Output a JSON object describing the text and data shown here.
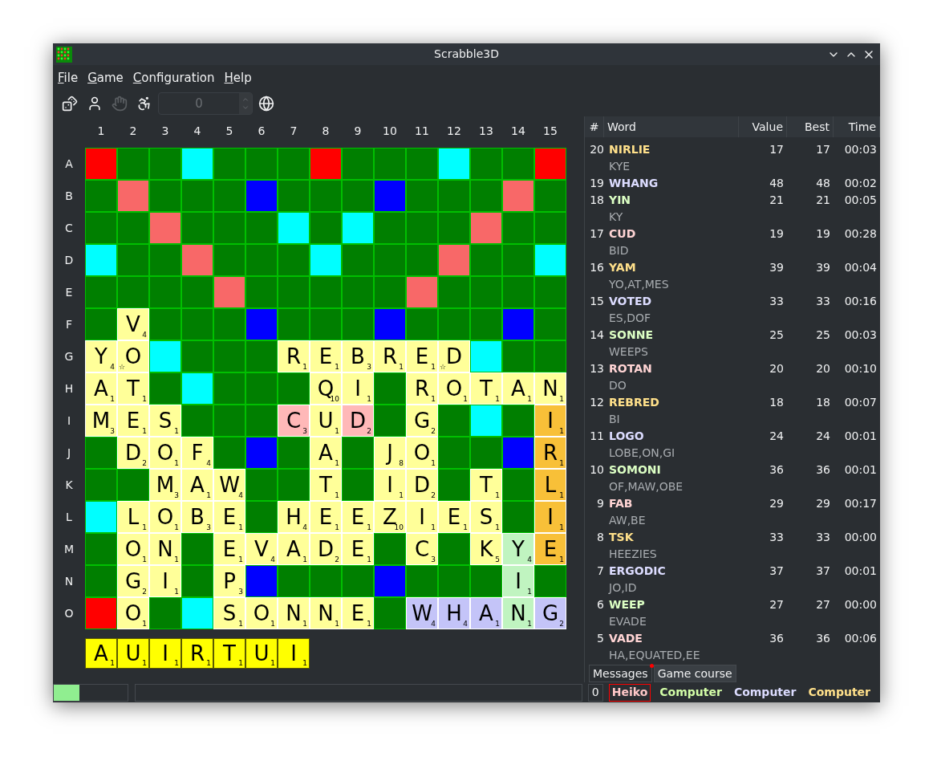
{
  "window": {
    "title": "Scrabble3D"
  },
  "menu": [
    {
      "label": "File"
    },
    {
      "label": "Game"
    },
    {
      "label": "Configuration"
    },
    {
      "label": "Help"
    }
  ],
  "toolbar": [
    {
      "kind": "dice",
      "disabled": false
    },
    {
      "kind": "player",
      "disabled": false
    },
    {
      "kind": "hand",
      "disabled": true
    },
    {
      "kind": "accessibility",
      "disabled": false
    },
    {
      "kind": "spinbox",
      "value": "0",
      "disabled": true
    },
    {
      "kind": "globe",
      "disabled": false
    }
  ],
  "board": {
    "columns": [
      "1",
      "2",
      "3",
      "4",
      "5",
      "6",
      "7",
      "8",
      "9",
      "10",
      "11",
      "12",
      "13",
      "14",
      "15"
    ],
    "rows": [
      {
        "label": "A",
        "cells": [
          {
            "kind": "tw"
          },
          {
            "kind": "plain"
          },
          {
            "kind": "plain"
          },
          {
            "kind": "dl"
          },
          {
            "kind": "plain"
          },
          {
            "kind": "plain"
          },
          {
            "kind": "plain"
          },
          {
            "kind": "tw"
          },
          {
            "kind": "plain"
          },
          {
            "kind": "plain"
          },
          {
            "kind": "plain"
          },
          {
            "kind": "dl"
          },
          {
            "kind": "plain"
          },
          {
            "kind": "plain"
          },
          {
            "kind": "tw"
          }
        ]
      },
      {
        "label": "B",
        "cells": [
          {
            "kind": "plain"
          },
          {
            "kind": "dw"
          },
          {
            "kind": "plain"
          },
          {
            "kind": "plain"
          },
          {
            "kind": "plain"
          },
          {
            "kind": "tl"
          },
          {
            "kind": "plain"
          },
          {
            "kind": "plain"
          },
          {
            "kind": "plain"
          },
          {
            "kind": "tl"
          },
          {
            "kind": "plain"
          },
          {
            "kind": "plain"
          },
          {
            "kind": "plain"
          },
          {
            "kind": "dw"
          },
          {
            "kind": "plain"
          }
        ]
      },
      {
        "label": "C",
        "cells": [
          {
            "kind": "plain"
          },
          {
            "kind": "plain"
          },
          {
            "kind": "dw"
          },
          {
            "kind": "plain"
          },
          {
            "kind": "plain"
          },
          {
            "kind": "plain"
          },
          {
            "kind": "dl"
          },
          {
            "kind": "plain"
          },
          {
            "kind": "dl"
          },
          {
            "kind": "plain"
          },
          {
            "kind": "plain"
          },
          {
            "kind": "plain"
          },
          {
            "kind": "dw"
          },
          {
            "kind": "plain"
          },
          {
            "kind": "plain"
          }
        ]
      },
      {
        "label": "D",
        "cells": [
          {
            "kind": "dl"
          },
          {
            "kind": "plain"
          },
          {
            "kind": "plain"
          },
          {
            "kind": "dw"
          },
          {
            "kind": "plain"
          },
          {
            "kind": "plain"
          },
          {
            "kind": "plain"
          },
          {
            "kind": "dl"
          },
          {
            "kind": "plain"
          },
          {
            "kind": "plain"
          },
          {
            "kind": "plain"
          },
          {
            "kind": "dw"
          },
          {
            "kind": "plain"
          },
          {
            "kind": "plain"
          },
          {
            "kind": "dl"
          }
        ]
      },
      {
        "label": "E",
        "cells": [
          {
            "kind": "plain"
          },
          {
            "kind": "plain"
          },
          {
            "kind": "plain"
          },
          {
            "kind": "plain"
          },
          {
            "kind": "dw"
          },
          {
            "kind": "plain"
          },
          {
            "kind": "plain"
          },
          {
            "kind": "plain"
          },
          {
            "kind": "plain"
          },
          {
            "kind": "plain"
          },
          {
            "kind": "dw"
          },
          {
            "kind": "plain"
          },
          {
            "kind": "plain"
          },
          {
            "kind": "plain"
          },
          {
            "kind": "plain"
          }
        ]
      },
      {
        "label": "F",
        "cells": [
          {
            "kind": "plain"
          },
          {
            "kind": "tile",
            "letter": "V",
            "points": "4",
            "color": "#ffff99"
          },
          {
            "kind": "plain"
          },
          {
            "kind": "plain"
          },
          {
            "kind": "plain"
          },
          {
            "kind": "tl"
          },
          {
            "kind": "plain"
          },
          {
            "kind": "plain"
          },
          {
            "kind": "plain"
          },
          {
            "kind": "tl"
          },
          {
            "kind": "plain"
          },
          {
            "kind": "plain"
          },
          {
            "kind": "plain"
          },
          {
            "kind": "tl"
          },
          {
            "kind": "plain"
          }
        ]
      },
      {
        "label": "G",
        "cells": [
          {
            "kind": "tile",
            "letter": "Y",
            "points": "4",
            "color": "#ffff99"
          },
          {
            "kind": "tile",
            "letter": "O",
            "mark": "☆",
            "color": "#ffff99"
          },
          {
            "kind": "dl"
          },
          {
            "kind": "plain"
          },
          {
            "kind": "plain"
          },
          {
            "kind": "plain"
          },
          {
            "kind": "tile",
            "letter": "R",
            "points": "1",
            "color": "#ffff99"
          },
          {
            "kind": "tile",
            "letter": "E",
            "points": "1",
            "color": "#ffff99"
          },
          {
            "kind": "tile",
            "letter": "B",
            "points": "3",
            "color": "#ffff99"
          },
          {
            "kind": "tile",
            "letter": "R",
            "points": "1",
            "color": "#ffff99"
          },
          {
            "kind": "tile",
            "letter": "E",
            "points": "1",
            "color": "#ffff99"
          },
          {
            "kind": "tile",
            "letter": "D",
            "mark": "☆",
            "color": "#ffff99"
          },
          {
            "kind": "dl"
          },
          {
            "kind": "plain"
          },
          {
            "kind": "plain"
          }
        ]
      },
      {
        "label": "H",
        "cells": [
          {
            "kind": "tile",
            "letter": "A",
            "points": "1",
            "color": "#ffff99"
          },
          {
            "kind": "tile",
            "letter": "T",
            "points": "1",
            "color": "#ffff99"
          },
          {
            "kind": "plain"
          },
          {
            "kind": "dl"
          },
          {
            "kind": "plain"
          },
          {
            "kind": "plain"
          },
          {
            "kind": "plain"
          },
          {
            "kind": "tile",
            "letter": "Q",
            "points": "10",
            "color": "#ffff99"
          },
          {
            "kind": "tile",
            "letter": "I",
            "points": "1",
            "color": "#ffff99"
          },
          {
            "kind": "plain"
          },
          {
            "kind": "tile",
            "letter": "R",
            "points": "1",
            "color": "#ffff99"
          },
          {
            "kind": "tile",
            "letter": "O",
            "points": "1",
            "color": "#ffff99"
          },
          {
            "kind": "tile",
            "letter": "T",
            "points": "1",
            "color": "#ffff99"
          },
          {
            "kind": "tile",
            "letter": "A",
            "points": "1",
            "color": "#ffff99"
          },
          {
            "kind": "tile",
            "letter": "N",
            "points": "1",
            "color": "#ffff99"
          }
        ]
      },
      {
        "label": "I",
        "cells": [
          {
            "kind": "tile",
            "letter": "M",
            "points": "3",
            "color": "#ffff99"
          },
          {
            "kind": "tile",
            "letter": "E",
            "points": "1",
            "color": "#ffff99"
          },
          {
            "kind": "tile",
            "letter": "S",
            "points": "1",
            "color": "#ffff99"
          },
          {
            "kind": "plain"
          },
          {
            "kind": "plain"
          },
          {
            "kind": "plain"
          },
          {
            "kind": "tile",
            "letter": "C",
            "points": "3",
            "color": "#ffb8b8"
          },
          {
            "kind": "tile",
            "letter": "U",
            "points": "1",
            "color": "#ffff99"
          },
          {
            "kind": "tile",
            "letter": "D",
            "points": "2",
            "color": "#ffb8b8"
          },
          {
            "kind": "plain"
          },
          {
            "kind": "tile",
            "letter": "G",
            "points": "2",
            "color": "#ffff99"
          },
          {
            "kind": "plain"
          },
          {
            "kind": "dl"
          },
          {
            "kind": "plain"
          },
          {
            "kind": "tile",
            "letter": "I",
            "points": "1",
            "color": "#f8c038"
          }
        ]
      },
      {
        "label": "J",
        "cells": [
          {
            "kind": "plain"
          },
          {
            "kind": "tile",
            "letter": "D",
            "points": "2",
            "color": "#ffff99"
          },
          {
            "kind": "tile",
            "letter": "O",
            "points": "1",
            "color": "#ffff99"
          },
          {
            "kind": "tile",
            "letter": "F",
            "points": "4",
            "color": "#ffff99"
          },
          {
            "kind": "plain"
          },
          {
            "kind": "tl"
          },
          {
            "kind": "plain"
          },
          {
            "kind": "tile",
            "letter": "A",
            "points": "1",
            "color": "#ffff99"
          },
          {
            "kind": "plain"
          },
          {
            "kind": "tile",
            "letter": "J",
            "points": "8",
            "color": "#ffff99"
          },
          {
            "kind": "tile",
            "letter": "O",
            "points": "1",
            "color": "#ffff99"
          },
          {
            "kind": "plain"
          },
          {
            "kind": "plain"
          },
          {
            "kind": "tl"
          },
          {
            "kind": "tile",
            "letter": "R",
            "points": "1",
            "color": "#f8c038"
          }
        ]
      },
      {
        "label": "K",
        "cells": [
          {
            "kind": "plain"
          },
          {
            "kind": "plain"
          },
          {
            "kind": "tile",
            "letter": "M",
            "points": "3",
            "color": "#ffff99"
          },
          {
            "kind": "tile",
            "letter": "A",
            "points": "1",
            "color": "#ffff99"
          },
          {
            "kind": "tile",
            "letter": "W",
            "points": "4",
            "color": "#ffff99"
          },
          {
            "kind": "plain"
          },
          {
            "kind": "plain"
          },
          {
            "kind": "tile",
            "letter": "T",
            "points": "1",
            "color": "#ffff99"
          },
          {
            "kind": "plain"
          },
          {
            "kind": "tile",
            "letter": "I",
            "points": "1",
            "color": "#ffff99"
          },
          {
            "kind": "tile",
            "letter": "D",
            "points": "2",
            "color": "#ffff99"
          },
          {
            "kind": "plain"
          },
          {
            "kind": "tile",
            "letter": "T",
            "points": "1",
            "color": "#ffff99"
          },
          {
            "kind": "plain"
          },
          {
            "kind": "tile",
            "letter": "L",
            "points": "1",
            "color": "#f8c038"
          }
        ]
      },
      {
        "label": "L",
        "cells": [
          {
            "kind": "dl"
          },
          {
            "kind": "tile",
            "letter": "L",
            "points": "1",
            "color": "#ffff99"
          },
          {
            "kind": "tile",
            "letter": "O",
            "points": "1",
            "color": "#ffff99"
          },
          {
            "kind": "tile",
            "letter": "B",
            "points": "3",
            "color": "#ffff99"
          },
          {
            "kind": "tile",
            "letter": "E",
            "points": "1",
            "color": "#ffff99"
          },
          {
            "kind": "plain"
          },
          {
            "kind": "tile",
            "letter": "H",
            "points": "4",
            "color": "#ffff99"
          },
          {
            "kind": "tile",
            "letter": "E",
            "points": "1",
            "color": "#ffff99"
          },
          {
            "kind": "tile",
            "letter": "E",
            "points": "1",
            "color": "#ffff99"
          },
          {
            "kind": "tile",
            "letter": "Z",
            "points": "10",
            "color": "#ffff99"
          },
          {
            "kind": "tile",
            "letter": "I",
            "points": "1",
            "color": "#ffff99"
          },
          {
            "kind": "tile",
            "letter": "E",
            "points": "1",
            "color": "#ffff99"
          },
          {
            "kind": "tile",
            "letter": "S",
            "points": "1",
            "color": "#ffff99"
          },
          {
            "kind": "plain"
          },
          {
            "kind": "tile",
            "letter": "I",
            "points": "1",
            "color": "#f8c038"
          }
        ]
      },
      {
        "label": "M",
        "cells": [
          {
            "kind": "plain"
          },
          {
            "kind": "tile",
            "letter": "O",
            "points": "1",
            "color": "#ffff99"
          },
          {
            "kind": "tile",
            "letter": "N",
            "points": "1",
            "color": "#ffff99"
          },
          {
            "kind": "plain"
          },
          {
            "kind": "tile",
            "letter": "E",
            "points": "1",
            "color": "#ffff99"
          },
          {
            "kind": "tile",
            "letter": "V",
            "points": "4",
            "color": "#ffff99"
          },
          {
            "kind": "tile",
            "letter": "A",
            "points": "1",
            "color": "#ffff99"
          },
          {
            "kind": "tile",
            "letter": "D",
            "points": "2",
            "color": "#ffff99"
          },
          {
            "kind": "tile",
            "letter": "E",
            "points": "1",
            "color": "#ffff99"
          },
          {
            "kind": "plain"
          },
          {
            "kind": "tile",
            "letter": "C",
            "points": "3",
            "color": "#ffff99"
          },
          {
            "kind": "plain"
          },
          {
            "kind": "tile",
            "letter": "K",
            "points": "5",
            "color": "#ffff99"
          },
          {
            "kind": "tile",
            "letter": "Y",
            "points": "4",
            "color": "#c0f4c0"
          },
          {
            "kind": "tile",
            "letter": "E",
            "points": "1",
            "color": "#f8c038"
          }
        ]
      },
      {
        "label": "N",
        "cells": [
          {
            "kind": "plain"
          },
          {
            "kind": "tile",
            "letter": "G",
            "points": "2",
            "color": "#ffff99"
          },
          {
            "kind": "tile",
            "letter": "I",
            "points": "1",
            "color": "#ffff99"
          },
          {
            "kind": "plain"
          },
          {
            "kind": "tile",
            "letter": "P",
            "points": "3",
            "color": "#ffff99"
          },
          {
            "kind": "tl"
          },
          {
            "kind": "plain"
          },
          {
            "kind": "plain"
          },
          {
            "kind": "plain"
          },
          {
            "kind": "tl"
          },
          {
            "kind": "plain"
          },
          {
            "kind": "plain"
          },
          {
            "kind": "plain"
          },
          {
            "kind": "tile",
            "letter": "I",
            "points": "1",
            "color": "#c0f4c0"
          },
          {
            "kind": "plain"
          }
        ]
      },
      {
        "label": "O",
        "cells": [
          {
            "kind": "tw"
          },
          {
            "kind": "tile",
            "letter": "O",
            "points": "1",
            "color": "#ffff99"
          },
          {
            "kind": "plain"
          },
          {
            "kind": "dl"
          },
          {
            "kind": "tile",
            "letter": "S",
            "points": "1",
            "color": "#ffff99"
          },
          {
            "kind": "tile",
            "letter": "O",
            "points": "1",
            "color": "#ffff99"
          },
          {
            "kind": "tile",
            "letter": "N",
            "points": "1",
            "color": "#ffff99"
          },
          {
            "kind": "tile",
            "letter": "N",
            "points": "1",
            "color": "#ffff99"
          },
          {
            "kind": "tile",
            "letter": "E",
            "points": "1",
            "color": "#ffff99"
          },
          {
            "kind": "plain"
          },
          {
            "kind": "tile",
            "letter": "W",
            "points": "4",
            "color": "#c4c4f8"
          },
          {
            "kind": "tile",
            "letter": "H",
            "points": "4",
            "color": "#c4c4f8"
          },
          {
            "kind": "tile",
            "letter": "A",
            "points": "1",
            "color": "#c4c4f8"
          },
          {
            "kind": "tile",
            "letter": "N",
            "points": "1",
            "color": "#c0f4c0"
          },
          {
            "kind": "tile",
            "letter": "G",
            "points": "2",
            "color": "#c4c4f8"
          }
        ]
      }
    ]
  },
  "rack": [
    {
      "letter": "A",
      "points": "1"
    },
    {
      "letter": "U",
      "points": "1"
    },
    {
      "letter": "I",
      "points": "1"
    },
    {
      "letter": "R",
      "points": "1"
    },
    {
      "letter": "T",
      "points": "1"
    },
    {
      "letter": "U",
      "points": "1"
    },
    {
      "letter": "I",
      "points": "1"
    }
  ],
  "moves": {
    "columns": [
      "#",
      "Word",
      "Value",
      "Best",
      "Time"
    ],
    "rows": [
      {
        "number": "20",
        "word": "NIRLIE",
        "extra": "KYE",
        "value": "17",
        "best": "17",
        "time": "00:03",
        "color": "#ffe08a"
      },
      {
        "number": "19",
        "word": "WHANG",
        "value": "48",
        "best": "48",
        "time": "00:02",
        "color": "#dcdcff"
      },
      {
        "number": "18",
        "word": "YIN",
        "extra": "KY",
        "value": "21",
        "best": "21",
        "time": "00:05",
        "color": "#dcffc4"
      },
      {
        "number": "17",
        "word": "CUD",
        "extra": "BID",
        "value": "19",
        "best": "19",
        "time": "00:28",
        "color": "#ffd4d4"
      },
      {
        "number": "16",
        "word": "YAM",
        "extra": "YO,AT,MES",
        "value": "39",
        "best": "39",
        "time": "00:04",
        "color": "#ffe08a"
      },
      {
        "number": "15",
        "word": "VOTED",
        "extra": "ES,DOF",
        "value": "33",
        "best": "33",
        "time": "00:16",
        "color": "#dcdcff"
      },
      {
        "number": "14",
        "word": "SONNE",
        "extra": "WEEPS",
        "value": "25",
        "best": "25",
        "time": "00:03",
        "color": "#dcffc4"
      },
      {
        "number": "13",
        "word": "ROTAN",
        "extra": "DO",
        "value": "20",
        "best": "20",
        "time": "00:10",
        "color": "#ffd4d4"
      },
      {
        "number": "12",
        "word": "REBRED",
        "extra": "BI",
        "value": "18",
        "best": "18",
        "time": "00:07",
        "color": "#ffe08a"
      },
      {
        "number": "11",
        "word": "LOGO",
        "extra": "LOBE,ON,GI",
        "value": "24",
        "best": "24",
        "time": "00:01",
        "color": "#dcdcff"
      },
      {
        "number": "10",
        "word": "SOMONI",
        "extra": "OF,MAW,OBE",
        "value": "36",
        "best": "36",
        "time": "00:01",
        "color": "#dcffc4"
      },
      {
        "number": "9",
        "word": "FAB",
        "extra": "AW,BE",
        "value": "29",
        "best": "29",
        "time": "00:17",
        "color": "#ffd4d4"
      },
      {
        "number": "8",
        "word": "TSK",
        "extra": "HEEZIES",
        "value": "33",
        "best": "33",
        "time": "00:00",
        "color": "#ffe08a"
      },
      {
        "number": "7",
        "word": "ERGODIC",
        "extra": "JO,ID",
        "value": "37",
        "best": "37",
        "time": "00:01",
        "color": "#dcdcff"
      },
      {
        "number": "6",
        "word": "WEEP",
        "extra": "EVADE",
        "value": "27",
        "best": "27",
        "time": "00:00",
        "color": "#dcffc4"
      },
      {
        "number": "5",
        "word": "VADE",
        "extra": "HA,EQUATED,EE",
        "value": "36",
        "best": "36",
        "time": "00:06",
        "color": "#ffd4d4"
      }
    ]
  },
  "tabs": [
    {
      "label": "Messages",
      "selected": false,
      "notification": true
    },
    {
      "label": "Game course",
      "selected": true,
      "notification": false
    }
  ],
  "status_bar": {
    "progress": {
      "level": 0.35
    },
    "count": "0",
    "players": [
      {
        "name": "Heiko",
        "color": "#ffc8c8",
        "selected": true
      },
      {
        "name": "Computer",
        "color": "#d4ffa8",
        "selected": false
      },
      {
        "name": "Computer",
        "color": "#dcdcff",
        "selected": false
      },
      {
        "name": "Computer",
        "color": "#ffe08a",
        "selected": false
      }
    ]
  }
}
